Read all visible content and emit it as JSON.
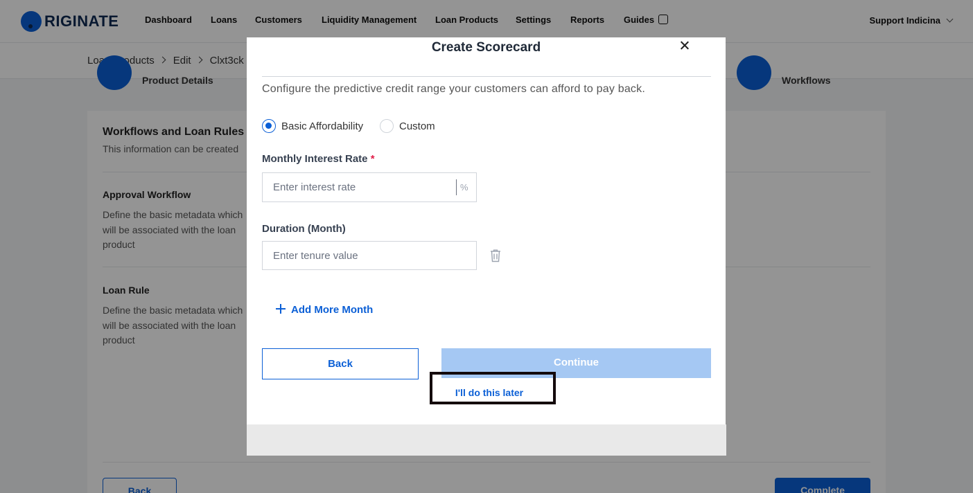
{
  "app": {
    "logo_text": "RIGINATE"
  },
  "nav": {
    "items": [
      "Dashboard",
      "Loans",
      "Customers",
      "Liquidity Management",
      "Loan Products",
      "Settings",
      "Reports",
      "Guides"
    ],
    "user": "Support Indicina"
  },
  "breadcrumb": {
    "items": [
      "Loan Products",
      "Edit",
      "Clxt3ck"
    ]
  },
  "steps": {
    "first": "Product Details",
    "last": "Workflows"
  },
  "background": {
    "section_title": "Workflows and Loan Rules",
    "section_subtitle": "This information can be created",
    "approval_title": "Approval Workflow",
    "approval_desc": "Define the basic metadata which will be associated with the loan product",
    "loanrule_title": "Loan Rule",
    "loanrule_desc": "Define the basic metadata which will be associated with the loan product",
    "back_label": "Back",
    "complete_label": "Complete"
  },
  "modal": {
    "title": "Create Scorecard",
    "description": "Configure the predictive credit range your customers can afford to pay back.",
    "options": [
      {
        "label": "Basic Affordability",
        "checked": true
      },
      {
        "label": "Custom",
        "checked": false
      }
    ],
    "interest_label": "Monthly Interest Rate",
    "interest_required": "*",
    "interest_placeholder": "Enter interest rate",
    "interest_suffix": "%",
    "duration_label": "Duration (Month)",
    "duration_placeholder": "Enter tenure value",
    "add_more": "Add More Month",
    "back": "Back",
    "continue": "Continue",
    "later": "I'll do this later"
  },
  "colors": {
    "primary": "#0b5fd6",
    "continue_disabled": "#a5c8f3",
    "highlight_border": "#140a0c"
  }
}
